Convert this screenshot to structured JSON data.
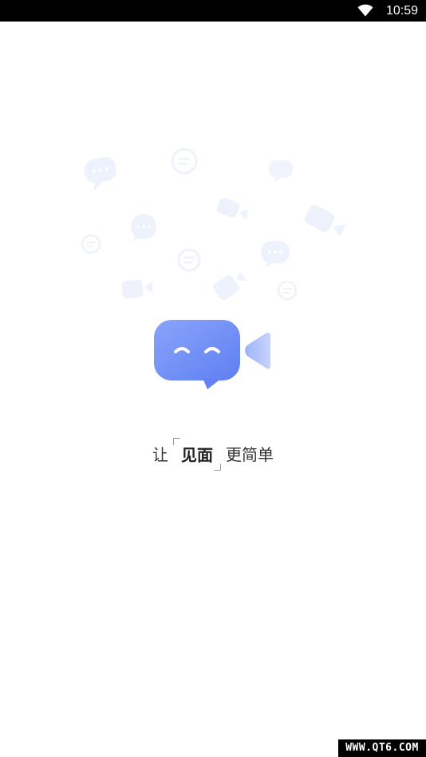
{
  "status_bar": {
    "time": "10:59",
    "wifi_icon": "wifi-icon"
  },
  "splash": {
    "logo_icon": "video-chat-logo-icon",
    "slogan": {
      "prefix": "让",
      "highlight": "见面",
      "suffix": "更简单"
    },
    "background_icons": [
      "chat-bubble-icon",
      "message-icon",
      "video-camera-icon"
    ]
  },
  "watermark": "WWW.QT6.COM",
  "colors": {
    "brand_gradient_start": "#5f7ff2",
    "brand_gradient_end": "#8ca6fb",
    "faint_icon": "#e8edfb",
    "status_bar": "#000000"
  }
}
